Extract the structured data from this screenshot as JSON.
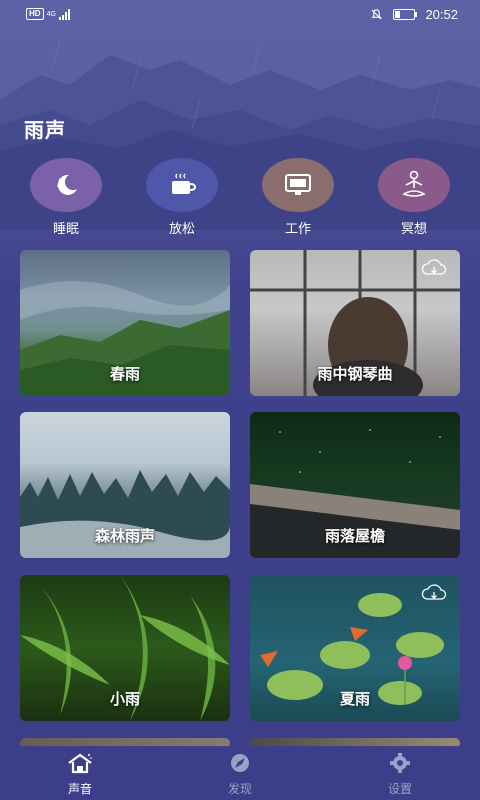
{
  "status_bar": {
    "network": "HD",
    "signal_type": "4G",
    "time": "20:52",
    "icons": [
      "mute-icon",
      "battery-icon"
    ]
  },
  "page": {
    "title": "雨声"
  },
  "categories": [
    {
      "label": "睡眠",
      "icon": "moon-stars-icon",
      "color": "#7b62a8"
    },
    {
      "label": "放松",
      "icon": "coffee-cup-icon",
      "color": "#4e57a8"
    },
    {
      "label": "工作",
      "icon": "monitor-icon",
      "color": "#8a6e6e"
    },
    {
      "label": "冥想",
      "icon": "meditation-icon",
      "color": "#8a5a8a"
    }
  ],
  "cards": [
    {
      "title": "春雨",
      "download": false
    },
    {
      "title": "雨中钢琴曲",
      "download": true
    },
    {
      "title": "森林雨声",
      "download": false
    },
    {
      "title": "雨落屋檐",
      "download": false
    },
    {
      "title": "小雨",
      "download": false
    },
    {
      "title": "夏雨",
      "download": true
    }
  ],
  "tabbar": {
    "tabs": [
      {
        "label": "声音",
        "icon": "home-icon",
        "active": true
      },
      {
        "label": "发现",
        "icon": "compass-icon",
        "active": false
      },
      {
        "label": "设置",
        "icon": "gear-icon",
        "active": false
      }
    ]
  }
}
